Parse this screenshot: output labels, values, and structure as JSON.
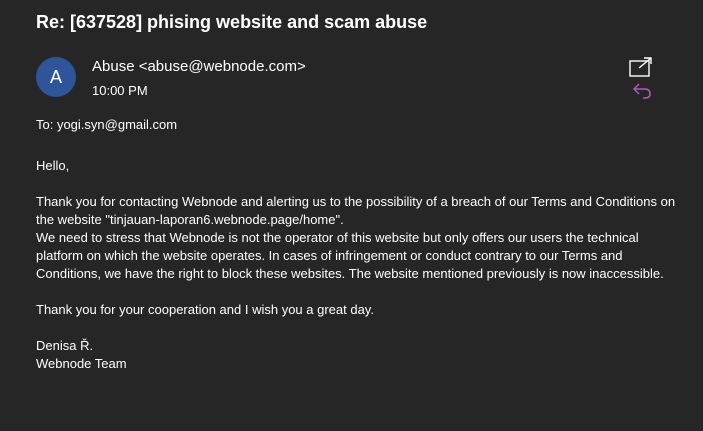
{
  "email": {
    "subject": "Re: [637528] phising website and scam abuse",
    "avatar_letter": "A",
    "sender": "Abuse <abuse@webnode.com>",
    "time": "10:00 PM",
    "to": "To: yogi.syn@gmail.com",
    "body": {
      "greeting": "Hello,",
      "para1_line1": "Thank you for contacting Webnode and alerting us to the possibility of a breach of our Terms and Conditions on",
      "para1_line2": "the website \"tinjauan-laporan6.webnode.page/home\".",
      "para1_line3": "We need to stress that Webnode is not the operator of this website but only offers our users the technical",
      "para1_line4": "platform on which the website operates. In cases of infringement or conduct contrary to our Terms and",
      "para1_line5": "Conditions, we have the right to block these websites. The website mentioned previously is now inaccessible.",
      "para2": "Thank you for your cooperation and I wish you a great day.",
      "signature_name": "Denisa Ř.",
      "signature_team": "Webnode Team"
    }
  },
  "icons": {
    "popout": "popout-icon",
    "reply": "reply-icon"
  },
  "colors": {
    "background": "#262626",
    "avatar": "#2e5599",
    "reply_icon": "#b45ab4",
    "text": "#ffffff"
  }
}
